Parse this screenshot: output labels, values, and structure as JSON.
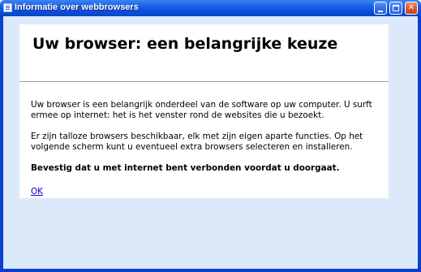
{
  "window": {
    "title": "Informatie over webbrowsers",
    "controls": {
      "minimize": "minimize",
      "maximize": "maximize",
      "close": "✕"
    }
  },
  "content": {
    "heading": "Uw browser: een belangrijke keuze",
    "paragraph1": "Uw browser is een belangrijk onderdeel van de software op uw computer. U surft ermee op internet: het is het venster rond de websites die u bezoekt.",
    "paragraph2": "Er zijn talloze browsers beschikbaar, elk met zijn eigen aparte functies. Op het volgende scherm kunt u eventueel extra browsers selecteren en installeren.",
    "paragraph3": "Bevestig dat u met internet bent verbonden voordat u doorgaat.",
    "ok_link": "OK"
  },
  "colors": {
    "titlebar": "#0a4fd8",
    "client_background": "#dce9fa",
    "link": "#0000cc"
  }
}
